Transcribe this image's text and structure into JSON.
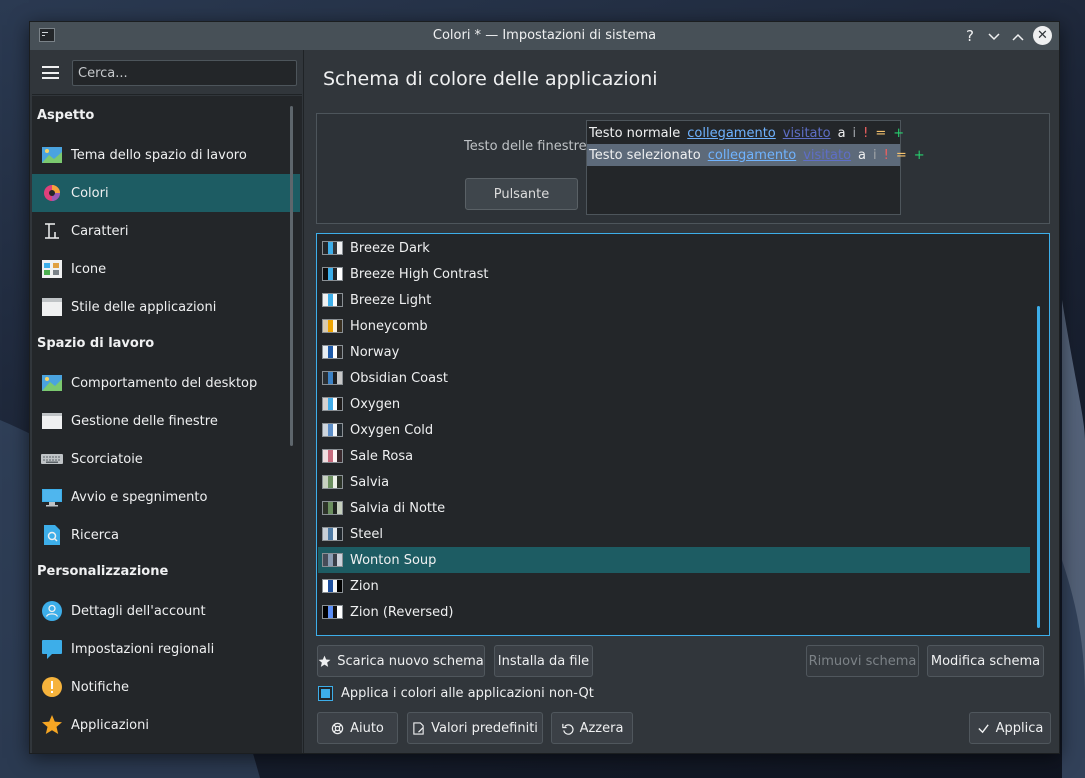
{
  "window": {
    "title": "Colori * — Impostazioni di sistema",
    "help_glyph": "?",
    "minimize_glyph": "⌄",
    "maximize_glyph": "⌃",
    "close_glyph": "✕"
  },
  "sidebar": {
    "search_placeholder": "Cerca...",
    "sections": [
      {
        "title": "Aspetto",
        "items": [
          {
            "label": "Tema dello spazio di lavoro",
            "icon": "workspace-theme-icon"
          },
          {
            "label": "Colori",
            "icon": "colors-icon",
            "active": true
          },
          {
            "label": "Caratteri",
            "icon": "fonts-icon"
          },
          {
            "label": "Icone",
            "icon": "icons-icon"
          },
          {
            "label": "Stile delle applicazioni",
            "icon": "app-style-icon"
          }
        ]
      },
      {
        "title": "Spazio di lavoro",
        "items": [
          {
            "label": "Comportamento del desktop",
            "icon": "desktop-behavior-icon"
          },
          {
            "label": "Gestione delle finestre",
            "icon": "window-management-icon"
          },
          {
            "label": "Scorciatoie",
            "icon": "keyboard-icon"
          },
          {
            "label": "Avvio e spegnimento",
            "icon": "startup-shutdown-icon"
          },
          {
            "label": "Ricerca",
            "icon": "search-icon"
          }
        ]
      },
      {
        "title": "Personalizzazione",
        "items": [
          {
            "label": "Dettagli dell'account",
            "icon": "user-icon"
          },
          {
            "label": "Impostazioni regionali",
            "icon": "regional-icon"
          },
          {
            "label": "Notifiche",
            "icon": "notification-icon"
          },
          {
            "label": "Applicazioni",
            "icon": "star-icon"
          }
        ]
      }
    ]
  },
  "main": {
    "title": "Schema di colore delle applicazioni",
    "preview": {
      "window_text_label": "Testo delle finestre",
      "button_label": "Pulsante",
      "normal": {
        "text": "Testo normale",
        "link": "collegamento",
        "visited": "visitato",
        "a": "a",
        "i": "i",
        "bang": "!",
        "eq": "=",
        "plus": "+"
      },
      "selected": {
        "text": "Testo selezionato",
        "link": "collegamento",
        "visited": "visitato",
        "a": "a",
        "i": "i",
        "bang": "!",
        "eq": "=",
        "plus": "+"
      }
    },
    "schemes": [
      {
        "name": "Breeze Dark",
        "colors": [
          "#232629",
          "#3daee9",
          "#31363b",
          "#eff0f1"
        ]
      },
      {
        "name": "Breeze High Contrast",
        "colors": [
          "#0d0d0d",
          "#3daee9",
          "#232629",
          "#ffffff"
        ]
      },
      {
        "name": "Breeze Light",
        "colors": [
          "#eff0f1",
          "#3daee9",
          "#fcfcfc",
          "#232629"
        ]
      },
      {
        "name": "Honeycomb",
        "colors": [
          "#d8cbb0",
          "#f0a500",
          "#faf3e2",
          "#3a3020"
        ]
      },
      {
        "name": "Norway",
        "colors": [
          "#e8eef2",
          "#1e5aa8",
          "#ffffff",
          "#2a2a2a"
        ]
      },
      {
        "name": "Obsidian Coast",
        "colors": [
          "#2a2f33",
          "#3c82c5",
          "#1c1f22",
          "#c7c7c7"
        ]
      },
      {
        "name": "Oxygen",
        "colors": [
          "#d6d2d0",
          "#43ace8",
          "#ffffff",
          "#1f1c1b"
        ]
      },
      {
        "name": "Oxygen Cold",
        "colors": [
          "#cfd6dd",
          "#5b8dc7",
          "#f4f7fa",
          "#222a30"
        ]
      },
      {
        "name": "Sale Rosa",
        "colors": [
          "#f0dde0",
          "#c96b7e",
          "#fff5f6",
          "#3b2a2e"
        ]
      },
      {
        "name": "Salvia",
        "colors": [
          "#c7d1c1",
          "#6b8f5f",
          "#eef2ea",
          "#2c3428"
        ]
      },
      {
        "name": "Salvia di Notte",
        "colors": [
          "#2d3329",
          "#6b8f5f",
          "#1f2420",
          "#c5cfbd"
        ]
      },
      {
        "name": "Steel",
        "colors": [
          "#c8cfd6",
          "#4f7ca6",
          "#e8edf1",
          "#1f262c"
        ]
      },
      {
        "name": "Wonton Soup",
        "colors": [
          "#474d59",
          "#8a9db3",
          "#3a3f48",
          "#cdd3dc"
        ],
        "selected": true
      },
      {
        "name": "Zion",
        "colors": [
          "#ffffff",
          "#1d4f9e",
          "#f5f5f5",
          "#000000"
        ]
      },
      {
        "name": "Zion (Reversed)",
        "colors": [
          "#000000",
          "#5c8ef5",
          "#101010",
          "#ffffff"
        ]
      }
    ],
    "buttons": {
      "download": "Scarica nuovo schema",
      "install": "Installa da file",
      "remove": "Rimuovi schema",
      "edit": "Modifica schema"
    },
    "apply_nonqt_label": "Applica i colori alle applicazioni non-Qt",
    "apply_nonqt_checked": true
  },
  "footer": {
    "help": "Aiuto",
    "defaults": "Valori predefiniti",
    "reset": "Azzera",
    "apply": "Applica"
  },
  "colors": {
    "accent": "#3daee9",
    "selection": "#1d5c63",
    "window_bg": "#31363b",
    "view_bg": "#232629"
  }
}
